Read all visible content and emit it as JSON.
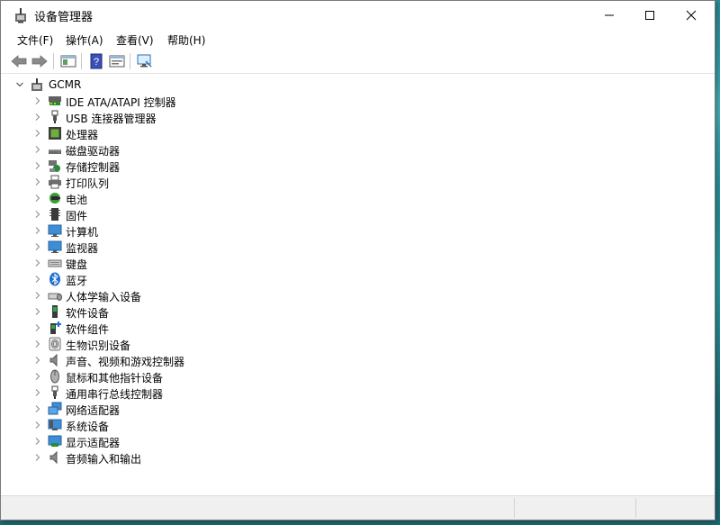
{
  "window": {
    "title": "设备管理器"
  },
  "menubar": {
    "items": [
      {
        "label": "文件(F)"
      },
      {
        "label": "操作(A)"
      },
      {
        "label": "查看(V)"
      },
      {
        "label": "帮助(H)"
      }
    ]
  },
  "tree": {
    "root": {
      "label": "GCMR",
      "icon": "computer-icon",
      "expanded": true
    },
    "items": [
      {
        "label": "IDE ATA/ATAPI 控制器",
        "icon": "ide-controller-icon"
      },
      {
        "label": "USB 连接器管理器",
        "icon": "usb-icon"
      },
      {
        "label": "处理器",
        "icon": "processor-icon"
      },
      {
        "label": "磁盘驱动器",
        "icon": "disk-drive-icon"
      },
      {
        "label": "存储控制器",
        "icon": "storage-controller-icon"
      },
      {
        "label": "打印队列",
        "icon": "printer-icon"
      },
      {
        "label": "电池",
        "icon": "battery-icon"
      },
      {
        "label": "固件",
        "icon": "firmware-icon"
      },
      {
        "label": "计算机",
        "icon": "monitor-icon"
      },
      {
        "label": "监视器",
        "icon": "monitor-icon"
      },
      {
        "label": "键盘",
        "icon": "keyboard-icon"
      },
      {
        "label": "蓝牙",
        "icon": "bluetooth-icon"
      },
      {
        "label": "人体学输入设备",
        "icon": "hid-icon"
      },
      {
        "label": "软件设备",
        "icon": "software-device-icon"
      },
      {
        "label": "软件组件",
        "icon": "software-component-icon"
      },
      {
        "label": "生物识别设备",
        "icon": "fingerprint-icon"
      },
      {
        "label": "声音、视频和游戏控制器",
        "icon": "speaker-icon"
      },
      {
        "label": "鼠标和其他指针设备",
        "icon": "mouse-icon"
      },
      {
        "label": "通用串行总线控制器",
        "icon": "usb-icon"
      },
      {
        "label": "网络适配器",
        "icon": "network-adapter-icon"
      },
      {
        "label": "系统设备",
        "icon": "system-device-icon"
      },
      {
        "label": "显示适配器",
        "icon": "display-adapter-icon"
      },
      {
        "label": "音频输入和输出",
        "icon": "speaker-icon"
      }
    ]
  }
}
